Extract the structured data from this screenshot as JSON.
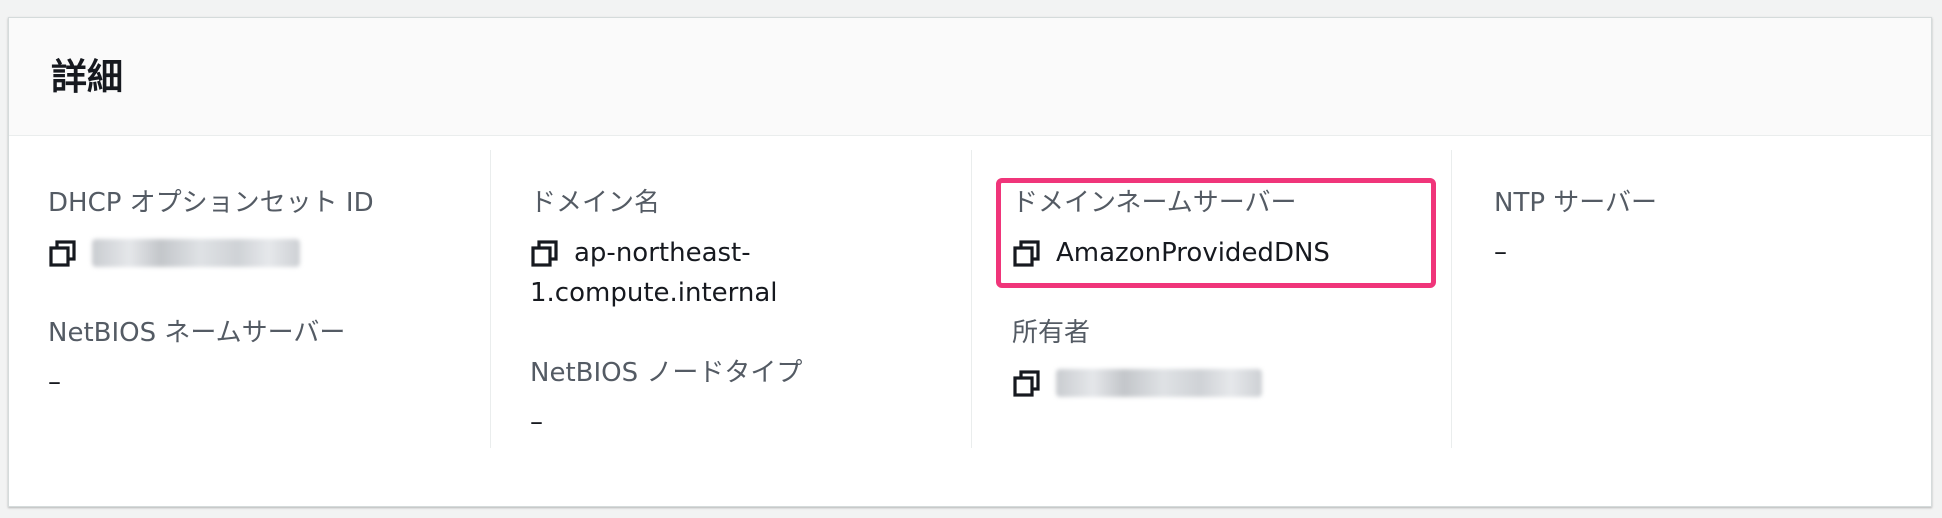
{
  "panel": {
    "title": "詳細"
  },
  "fields": {
    "dhcp_option_set_id": {
      "label": "DHCP オプションセット ID",
      "value": ""
    },
    "netbios_name_servers": {
      "label": "NetBIOS ネームサーバー",
      "value": "–"
    },
    "domain_name": {
      "label": "ドメイン名",
      "value": "ap-northeast-1.compute.internal",
      "value_line1": "ap-northeast-",
      "value_line2": "1.compute.internal"
    },
    "netbios_node_type": {
      "label": "NetBIOS ノードタイプ",
      "value": "–"
    },
    "domain_name_servers": {
      "label": "ドメインネームサーバー",
      "value": "AmazonProvidedDNS"
    },
    "owner": {
      "label": "所有者",
      "value": ""
    },
    "ntp_servers": {
      "label": "NTP サーバー",
      "value": "–"
    }
  },
  "icons": {
    "copy": "copy-icon"
  },
  "colors": {
    "highlight": "#f0357a",
    "label": "#545b64",
    "text": "#16191f",
    "header_bg": "#fafafa",
    "page_bg": "#f2f3f3"
  }
}
